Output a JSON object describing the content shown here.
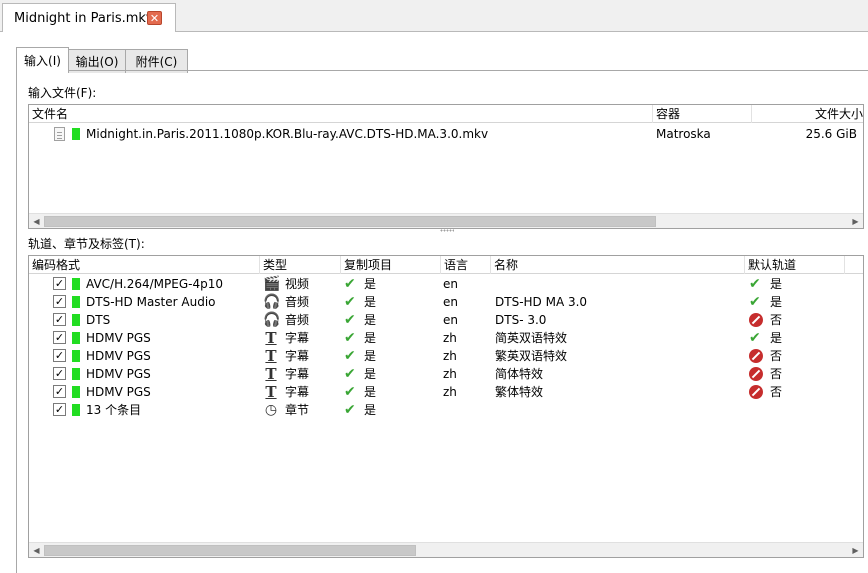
{
  "document_tab": {
    "title": "Midnight in Paris.mkv",
    "close_glyph": "✕"
  },
  "subtabs": [
    {
      "label": "输入(I)",
      "active": true
    },
    {
      "label": "输出(O)",
      "active": false
    },
    {
      "label": "附件(C)",
      "active": false
    }
  ],
  "input_files": {
    "label": "输入文件(F):",
    "columns": [
      "文件名",
      "容器",
      "文件大小"
    ],
    "rows": [
      {
        "name": "Midnight.in.Paris.2011.1080p.KOR.Blu-ray.AVC.DTS-HD.MA.3.0.mkv",
        "container": "Matroska",
        "size": "25.6 GiB"
      }
    ]
  },
  "tracks": {
    "label": "轨道、章节及标签(T):",
    "columns": [
      "编码格式",
      "类型",
      "复制项目",
      "语言",
      "名称",
      "默认轨道"
    ],
    "check_glyph": "✓",
    "rows": [
      {
        "codec": "AVC/H.264/MPEG-4p10",
        "type": "视频",
        "type_icon": "film-clapper-icon",
        "copy": "是",
        "lang": "en",
        "name": "",
        "default": "是",
        "default_yes": true
      },
      {
        "codec": "DTS-HD Master Audio",
        "type": "音频",
        "type_icon": "headphones-icon",
        "copy": "是",
        "lang": "en",
        "name": "DTS-HD MA 3.0",
        "default": "是",
        "default_yes": true
      },
      {
        "codec": "DTS",
        "type": "音频",
        "type_icon": "headphones-icon",
        "copy": "是",
        "lang": "en",
        "name": "DTS- 3.0",
        "default": "否",
        "default_yes": false
      },
      {
        "codec": "HDMV PGS",
        "type": "字幕",
        "type_icon": "text-t-icon",
        "copy": "是",
        "lang": "zh",
        "name": "简英双语特效",
        "default": "是",
        "default_yes": true
      },
      {
        "codec": "HDMV PGS",
        "type": "字幕",
        "type_icon": "text-t-icon",
        "copy": "是",
        "lang": "zh",
        "name": "繁英双语特效",
        "default": "否",
        "default_yes": false
      },
      {
        "codec": "HDMV PGS",
        "type": "字幕",
        "type_icon": "text-t-icon",
        "copy": "是",
        "lang": "zh",
        "name": "简体特效",
        "default": "否",
        "default_yes": false
      },
      {
        "codec": "HDMV PGS",
        "type": "字幕",
        "type_icon": "text-t-icon",
        "copy": "是",
        "lang": "zh",
        "name": "繁体特效",
        "default": "否",
        "default_yes": false
      },
      {
        "codec": "13 个条目",
        "type": "章节",
        "type_icon": "clock-icon",
        "copy": "是",
        "lang": "",
        "name": "",
        "default": "",
        "default_yes": null
      }
    ]
  },
  "colors": {
    "track_marker": "#22dd22",
    "yes_check": "#3aa635",
    "no_circle": "#c62d2d",
    "close_button": "#e36b4f"
  }
}
